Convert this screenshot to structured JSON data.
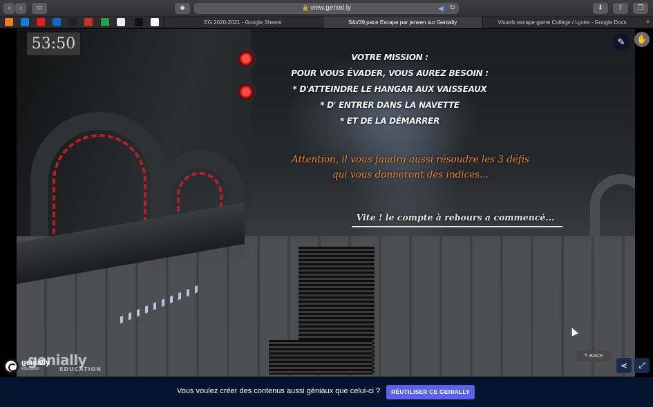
{
  "browser": {
    "url": "view.genial.ly",
    "tabs": [
      {
        "label": "EG 2020-2021 - Google Sheets",
        "active": false
      },
      {
        "label": "S&#39;pace Escape par jeneen sur Genially",
        "active": true
      },
      {
        "label": "Visuels escape game Collège / Lycée - Google Docs",
        "active": false
      }
    ],
    "favicons": [
      "bookmark-icon",
      "twitter-icon",
      "youtube-icon",
      "outlook-icon",
      "fx-icon",
      "gmail-icon",
      "drive-icon",
      "nike-icon",
      "dark-icon",
      "google-icon"
    ]
  },
  "presentation": {
    "timer": "53:50",
    "mission_lines": [
      "VOTRE MISSION :",
      "POUR VOUS ÉVADER, VOUS AUREZ BESOIN :",
      "* D'ATTEINDRE LE HANGAR AUX VAISSEAUX",
      "* D' ENTRER DANS LA NAVETTE",
      "* ET DE LA DÉMARRER"
    ],
    "attention_lines": [
      "Attention, il vous faudra aussi résoudre les 3 défis",
      "qui vous donneront des indices..."
    ],
    "countdown_text": "Vite ! le compte à rebours a commencé...",
    "back_label": "BACK",
    "logo_text": "genially",
    "logo_sub": "EDUCATION",
    "small_logo_text": "genially",
    "small_logo_sub": "education"
  },
  "banner": {
    "text": "Vous voulez créer des contenus aussi géniaux que celui-ci ?",
    "button_label": "RÉUTILISER CE GENIALLY"
  },
  "colors": {
    "banner_bg": "#061330",
    "button_accent": "#5b62e3",
    "attention_text": "#f08a3a"
  }
}
